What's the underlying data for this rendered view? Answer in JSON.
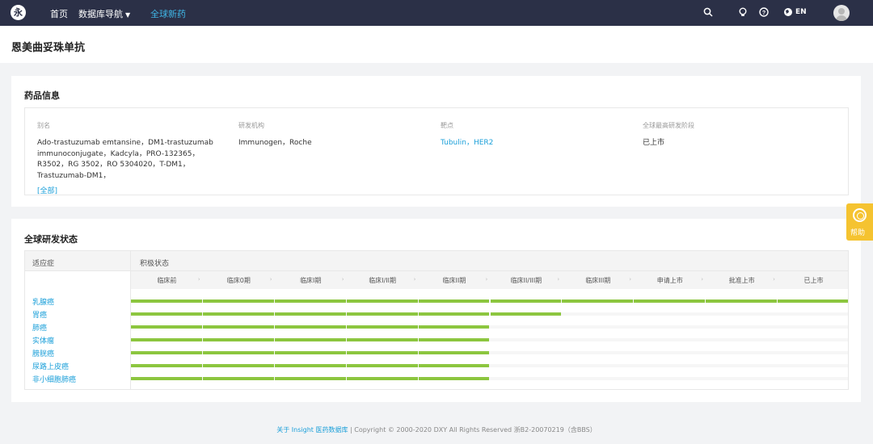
{
  "nav": {
    "logo_glyph": "永",
    "home": "首页",
    "db_nav": "数据库导航",
    "active": "全球新药",
    "lang": "EN",
    "icons": [
      "search-icon",
      "bulb-icon",
      "help-icon",
      "globe-icon",
      "avatar"
    ]
  },
  "page": {
    "title": "恩美曲妥珠单抗"
  },
  "drug_info": {
    "section_title": "药品信息",
    "alias_label": "别名",
    "alias_value": "Ado-trastuzumab emtansine，DM1-trastuzumab immunoconjugate，Kadcyla，PRO-132365，R3502，RG 3502，RO 5304020，T-DM1，Trastuzumab-DM1，",
    "alias_more": "[全部]",
    "org_label": "研发机构",
    "org_value": "Immunogen，Roche",
    "target_label": "靶点",
    "target_value": "Tubulin，HER2",
    "stage_label": "全球最高研发阶段",
    "stage_value": "已上市"
  },
  "status": {
    "section_title": "全球研发状态",
    "col_indication": "适应症",
    "col_status": "积极状态",
    "phases": [
      "临床前",
      "临床0期",
      "临床I期",
      "临床I/II期",
      "临床II期",
      "临床II/III期",
      "临床III期",
      "申请上市",
      "批准上市",
      "已上市"
    ],
    "rows": [
      {
        "indication": "乳腺癌",
        "reached": 10
      },
      {
        "indication": "胃癌",
        "reached": 6
      },
      {
        "indication": "肺癌",
        "reached": 5
      },
      {
        "indication": "实体瘤",
        "reached": 5
      },
      {
        "indication": "膀胱癌",
        "reached": 5
      },
      {
        "indication": "尿路上皮癌",
        "reached": 5
      },
      {
        "indication": "非小细胞肺癌",
        "reached": 5
      }
    ],
    "bar_color": "#8cc63f"
  },
  "help": {
    "label": "帮助"
  },
  "footer": {
    "link": "关于 Insight 医药数据库",
    "copyright": "| Copyright © 2000-2020 DXY All Rights Reserved 浙B2-20070219（含BBS）"
  },
  "colors": {
    "nav_bg": "#2b3047",
    "accent": "#1a9fd9",
    "help_bg": "#f5c330"
  }
}
